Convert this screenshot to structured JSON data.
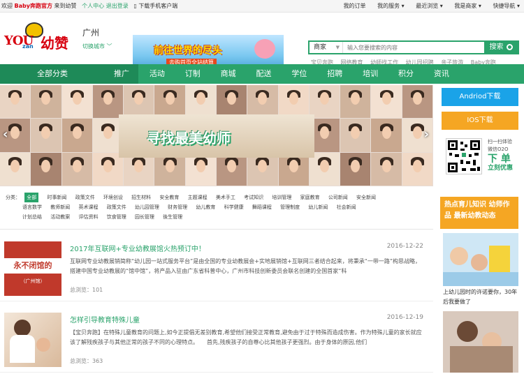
{
  "topbar": {
    "welcome": "欢迎",
    "brand": "Baby奔跑官方",
    "come": "来到幼赞",
    "user_center": "个人中心",
    "logout": "退出登录",
    "download": "下载手机客户端",
    "right_links": [
      "我的订单",
      "我的服务 ▾",
      "最近浏览 ▾",
      "我是商家 ▾",
      "快捷导航 ▾"
    ]
  },
  "header": {
    "logo_you": "YOU",
    "logo_zan": "zan",
    "logo_cn": "幼赞",
    "city": "广州",
    "change_city": "切换城市",
    "ad_title": "前往世界的尽头",
    "ad_sub": "去购首页全站结算",
    "search": {
      "category": "商家",
      "placeholder": "输入您要搜索的内容",
      "button": "搜索"
    },
    "hot_words": [
      "宝贝奔跑",
      "网络教育",
      "幼師找工作",
      "幼儿园招聘",
      "亲子旅游",
      "Baby奔跑"
    ]
  },
  "nav": {
    "all": "全部分类",
    "items": [
      "推广",
      "活动",
      "订制",
      "商城",
      "配送",
      "学位",
      "招聘",
      "培训",
      "积分",
      "资讯"
    ],
    "active_index": 0
  },
  "slider": {
    "title": "寻找最美幼师",
    "prev": "‹",
    "next": "›"
  },
  "side": {
    "android": "Andriod下载",
    "ios": "IOS下载",
    "qr_line1": "扫一扫体验",
    "qr_line2": "微信O2O",
    "qr_big": "下 单",
    "qr_small": "立刻优惠"
  },
  "categories": {
    "label": "分类：",
    "rows": [
      [
        "全部",
        "时事新闻",
        "政策文件",
        "环境创设",
        "招生材料",
        "安全教育",
        "主题课程",
        "美术手工",
        "考试知识",
        "培训管理",
        "家庭教育",
        "公司新闻",
        "安全新闻"
      ],
      [
        "语言数学",
        "教师新闻",
        "英术课程",
        "政策文件",
        "幼儿园管理",
        "财务管理",
        "幼儿教育",
        "科学健康",
        "舞蹈课程",
        "管理制度",
        "幼儿新闻",
        "社会新闻"
      ],
      [
        "计划总结",
        "活动教案",
        "评估资料",
        "饮食管理",
        "园长管理",
        "後生管理"
      ]
    ]
  },
  "articles": [
    {
      "title": "2017年互联网+专业幼教展馆火热预订中！",
      "date": "2016-12-22",
      "desc": "互联网专业幼教展销简称“幼儿园一站式服务平台”是由全国的专业幼教展会+实地展销馆+互联网三者结合起来，将秉承“一带一路”构思战略，搭建中国专业幼教展的“馆中馆”，将产品入驻由广东省科普中心，广州市科技创新委员会联名创建的全国首家“科",
      "views_label": "总浏览：",
      "views": "101",
      "thumb_text": "永不闭馆的",
      "thumb_sub": "（广州馆）"
    },
    {
      "title": "怎样引导教育特殊儿童",
      "date": "2016-12-19",
      "desc": "【宝贝奔跑】在特殊儿童教育的问题上,如今正提倡无差别教育,希望他们接受正常教育,避免由于过于特殊而造成伤害。作为特殊儿童的家长就应该了解残疾孩子与其他正常的孩子不同的心理特点。　　首先,残疾孩子的自尊心比其他孩子更强烈。由于身体的原因,他们",
      "views_label": "总浏览：",
      "views": "363"
    }
  ],
  "hot": {
    "title": "热点育儿知识 幼师作品 最新幼教动态",
    "caption": "上幼儿园时的许诺要你，30年后我要做了"
  },
  "colors": {
    "green": "#2aa36b",
    "dark_green": "#1e8a58",
    "blue": "#1aa3e8",
    "orange": "#f5a623",
    "red": "#d7000f"
  }
}
